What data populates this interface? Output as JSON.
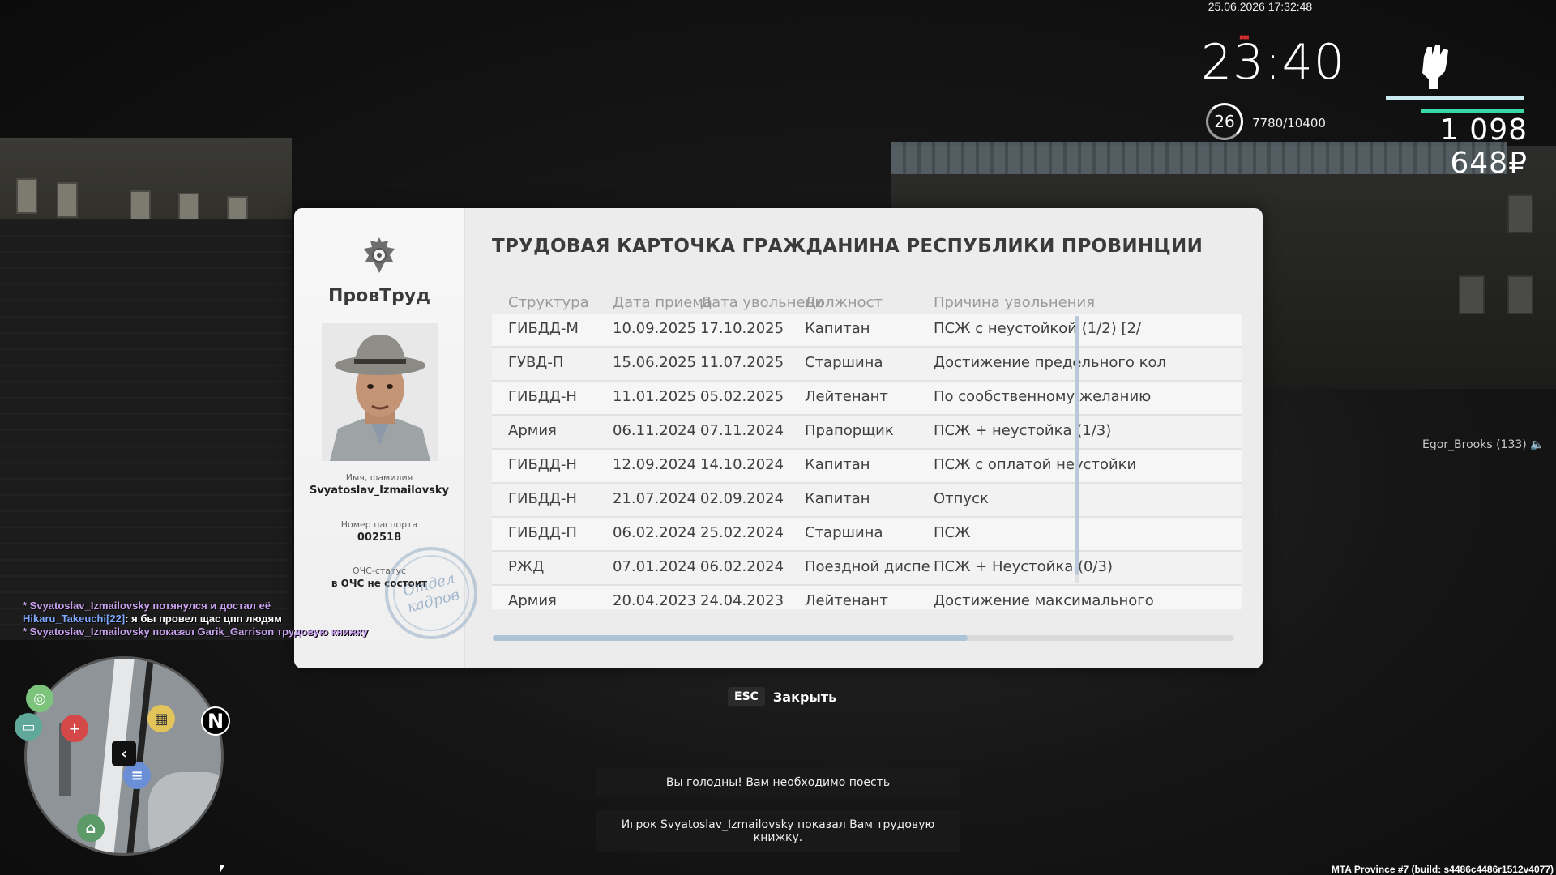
{
  "hud": {
    "datetime": "25.06.2026 17:32:48",
    "time": "23:40",
    "level": "26",
    "xp": "7780/10400",
    "money": "1 098 648₽",
    "hunger_icon": "hunger-icon",
    "fist_icon": "fist-icon",
    "health_fraction": 1.0,
    "armor_fraction": 0.75,
    "colors": {
      "health": "#c8eaf0",
      "armor": "#38d8a8",
      "hunger": "#e03030"
    }
  },
  "player_tag": "Egor_Brooks (133) 🔈",
  "card": {
    "brand": "ПровТруд",
    "title": "ТРУДОВАЯ КАРТОЧКА ГРАЖДАНИНА РЕСПУБЛИКИ ПРОВИНЦИИ",
    "name_label": "Имя, фамилия",
    "name_value": "Svyatoslav_Izmailovsky",
    "passport_label": "Номер паспорта",
    "passport_value": "002518",
    "ochs_label": "ОЧС-статус",
    "ochs_value": "в ОЧС не состоит",
    "stamp_line1": "Отдел",
    "stamp_line2": "кадров",
    "columns": [
      "Структура",
      "Дата приема",
      "Дата увольнени",
      "Должност",
      "Причина увольнения"
    ],
    "rows": [
      [
        "ГИБДД-М",
        "10.09.2025",
        "17.10.2025",
        "Капитан",
        "ПСЖ с неустойкой (1/2) [2/"
      ],
      [
        "ГУВД-П",
        "15.06.2025",
        "11.07.2025",
        "Старшина",
        "Достижение предельного кол"
      ],
      [
        "ГИБДД-Н",
        "11.01.2025",
        "05.02.2025",
        "Лейтенант",
        "По сообственному желанию"
      ],
      [
        "Армия",
        "06.11.2024",
        "07.11.2024",
        "Прапорщик",
        "ПСЖ + неустойка (1/3)"
      ],
      [
        "ГИБДД-Н",
        "12.09.2024",
        "14.10.2024",
        "Капитан",
        "ПСЖ с оплатой неустойки"
      ],
      [
        "ГИБДД-Н",
        "21.07.2024",
        "02.09.2024",
        "Капитан",
        "Отпуск"
      ],
      [
        "ГИБДД-П",
        "06.02.2024",
        "25.02.2024",
        "Старшина",
        "ПСЖ"
      ],
      [
        "РЖД",
        "07.01.2024",
        "06.02.2024",
        "Поездной диспетчер",
        "ПСЖ + Неустойка (0/3)"
      ],
      [
        "Армия",
        "20.04.2023",
        "24.04.2023",
        "Лейтенант",
        "Достижение максимального"
      ]
    ]
  },
  "close": {
    "key": "ESC",
    "label": "Закрыть"
  },
  "notices": [
    "Вы голодны! Вам необходимо поесть",
    "Игрок Svyatoslav_Izmailovsky показал Вам трудовую книжку."
  ],
  "chat": {
    "line1": "* Svyatoslav_Izmailovsky потянулся и достал её",
    "line2_name": "Hikaru_Takeuchi[22]",
    "line2_text": ": я бы провел щас цпп людям",
    "line3": "* Svyatoslav_Izmailovsky показал Garik_Garrison трудовую книжку"
  },
  "minimap": {
    "north_label": "N"
  },
  "build": "MTA Province #7 (build: s4486c4486r1512v4077)"
}
